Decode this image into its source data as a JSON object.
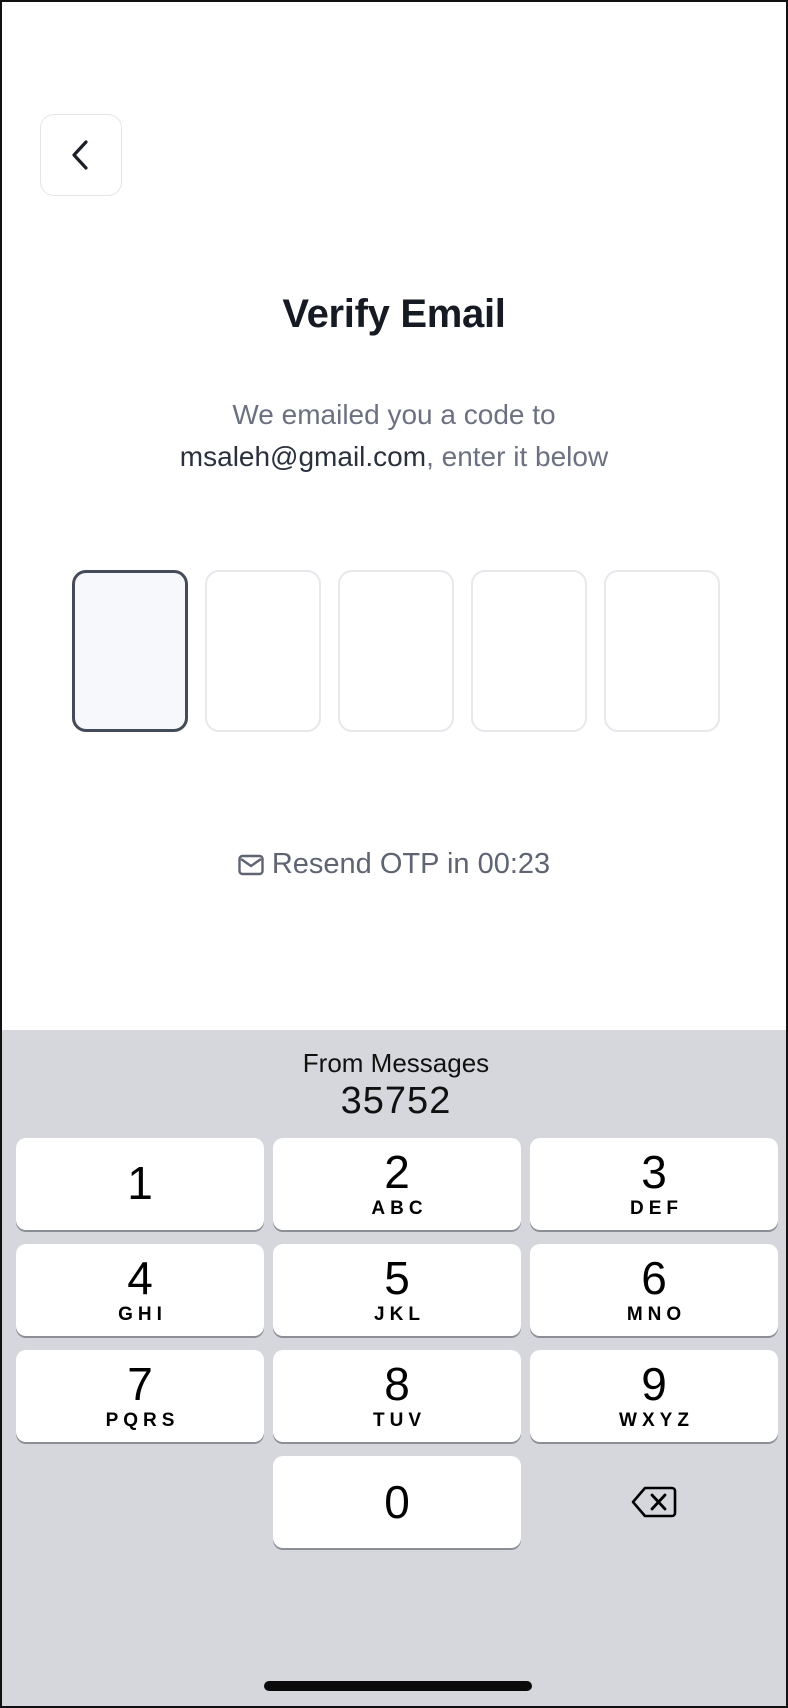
{
  "header": {
    "title": "Verify Email",
    "subtitle_line1": "We emailed you a code to",
    "email": "msaleh@gmail.com",
    "subtitle_suffix": ", enter it below"
  },
  "otp": {
    "length": 5,
    "active_index": 0,
    "values": [
      "",
      "",
      "",
      "",
      ""
    ]
  },
  "resend": {
    "label": "Resend OTP in 00:23"
  },
  "keyboard": {
    "suggestion_label": "From Messages",
    "suggestion_code": "35752",
    "keys": [
      {
        "num": "1",
        "letters": ""
      },
      {
        "num": "2",
        "letters": "ABC"
      },
      {
        "num": "3",
        "letters": "DEF"
      },
      {
        "num": "4",
        "letters": "GHI"
      },
      {
        "num": "5",
        "letters": "JKL"
      },
      {
        "num": "6",
        "letters": "MNO"
      },
      {
        "num": "7",
        "letters": "PQRS"
      },
      {
        "num": "8",
        "letters": "TUV"
      },
      {
        "num": "9",
        "letters": "WXYZ"
      },
      {
        "num": "0",
        "letters": ""
      }
    ]
  },
  "icons": {
    "back": "chevron-left-icon",
    "mail": "mail-icon",
    "delete": "backspace-icon"
  },
  "colors": {
    "keyboard_bg": "#d5d7dc",
    "active_box_border": "#454c59",
    "muted_text": "#6b7180"
  }
}
